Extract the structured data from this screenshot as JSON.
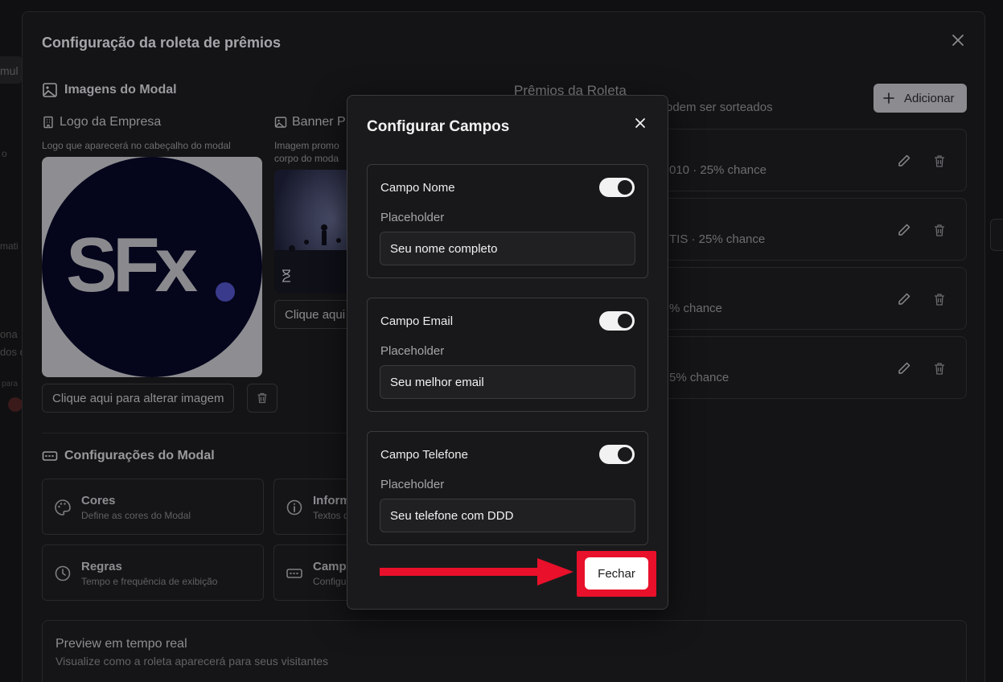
{
  "outer_modal": {
    "title": "Configuração da roleta de prêmios",
    "images_section": {
      "title": "Imagens do Modal",
      "logo": {
        "title": "Logo da Empresa",
        "hint": "Logo que aparecerá no cabeçalho do modal",
        "logo_text": "SFx",
        "change_label": "Clique aqui para alterar imagem"
      },
      "banner": {
        "title": "Banner P",
        "hint_line1": "Imagem promo",
        "hint_line2": "corpo do moda",
        "change_label": "Clique aqui"
      }
    },
    "settings_section": {
      "title": "Configurações do Modal",
      "cards": [
        {
          "title": "Cores",
          "subtitle": "Define as cores do Modal",
          "icon": "palette-icon"
        },
        {
          "title": "Inform",
          "subtitle": "Textos d",
          "icon": "info-icon"
        },
        {
          "title": "Regras",
          "subtitle": "Tempo e frequência de exibição",
          "icon": "clock-icon"
        },
        {
          "title": "Camp",
          "subtitle": "Configu",
          "icon": "input-field-icon"
        }
      ]
    },
    "prizes_section": {
      "title": "Prêmios da Roleta",
      "subtitle": "odem ser sorteados",
      "add_label": "Adicionar",
      "items": [
        {
          "info": "010 · 25% chance"
        },
        {
          "info": "TIS · 25% chance"
        },
        {
          "info": "% chance"
        },
        {
          "info": "5% chance"
        }
      ]
    },
    "preview": {
      "title": "Preview em tempo real",
      "subtitle": "Visualize como a roleta aparecerá para seus visitantes"
    }
  },
  "dialog": {
    "title": "Configurar Campos",
    "fields": [
      {
        "label": "Campo Nome",
        "enabled": true,
        "placeholder_label": "Placeholder",
        "placeholder_value": "Seu nome completo"
      },
      {
        "label": "Campo Email",
        "enabled": true,
        "placeholder_label": "Placeholder",
        "placeholder_value": "Seu melhor email"
      },
      {
        "label": "Campo Telefone",
        "enabled": true,
        "placeholder_label": "Placeholder",
        "placeholder_value": "Seu telefone com DDD"
      }
    ],
    "close_label": "Fechar"
  },
  "background_fragments": {
    "left": [
      "mul",
      "o",
      "mati",
      "ona",
      "dos d",
      "para"
    ]
  },
  "colors": {
    "highlight": "#e8102a",
    "dialog_bg": "#1a1a1c",
    "logo_circle": "#05061c",
    "logo_dot": "#3a3a8c"
  }
}
